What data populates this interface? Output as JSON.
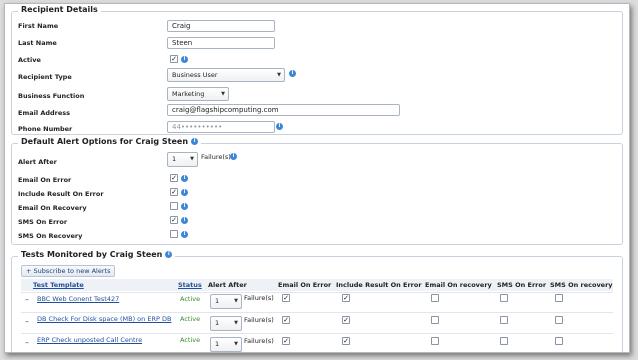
{
  "recipient": {
    "legend": "Recipient Details",
    "first_name_label": "First Name",
    "first_name_value": "Craig",
    "last_name_label": "Last Name",
    "last_name_value": "Steen",
    "active_label": "Active",
    "active_checked": true,
    "type_label": "Recipient Type",
    "type_value": "Business User",
    "function_label": "Business Function",
    "function_value": "Marketing",
    "email_label": "Email Address",
    "email_value": "craig@flagshipcomputing.com",
    "phone_label": "Phone Number",
    "phone_value": "44••••••••••"
  },
  "defaults": {
    "legend": "Default Alert Options for Craig Steen",
    "alert_after_label": "Alert After",
    "alert_after_value": "1",
    "failures_label": "Failure(s)",
    "options": [
      {
        "label": "Email On Error",
        "checked": true
      },
      {
        "label": "Include Result On Error",
        "checked": true
      },
      {
        "label": "Email On Recovery",
        "checked": false
      },
      {
        "label": "SMS On Error",
        "checked": true
      },
      {
        "label": "SMS On Recovery",
        "checked": false
      }
    ]
  },
  "tests": {
    "legend": "Tests Monitored by Craig Steen",
    "subscribe_label": "+ Subscribe to new Alerts",
    "columns": {
      "template": "Test Template",
      "status": "Status",
      "alert_after": "Alert After",
      "email_on_error": "Email On Error",
      "include_result": "Include Result On Error",
      "email_on_recovery": "Email On recovery",
      "sms_on_error": "SMS On Error",
      "sms_on_recovery": "SMS On recovery"
    },
    "rows": [
      {
        "dash": "–",
        "template": "BBC Web Conent Test427",
        "status": "Active",
        "alert_after": "1",
        "failures": "Failure(s)",
        "email_on_error": true,
        "include_result": true,
        "email_on_recovery": false,
        "sms_on_error": false,
        "sms_on_recovery": false
      },
      {
        "dash": "–",
        "template": "DB Check For Disk space (MB) on ERP DB",
        "status": "Active",
        "alert_after": "1",
        "failures": "Failure(s)",
        "email_on_error": true,
        "include_result": true,
        "email_on_recovery": false,
        "sms_on_error": false,
        "sms_on_recovery": false
      },
      {
        "dash": "–",
        "template": "ERP Check unposted Call Centre",
        "status": "Active",
        "alert_after": "1",
        "failures": "Failure(s)",
        "email_on_error": true,
        "include_result": true,
        "email_on_recovery": false,
        "sms_on_error": false,
        "sms_on_recovery": false
      }
    ]
  },
  "icons": {
    "info": "info-icon",
    "caret": "chevron-down-icon",
    "check": "checkmark-icon"
  },
  "colors": {
    "link": "#1f4e9c",
    "active_status": "#3a8a2e",
    "info": "#3b86d6"
  }
}
